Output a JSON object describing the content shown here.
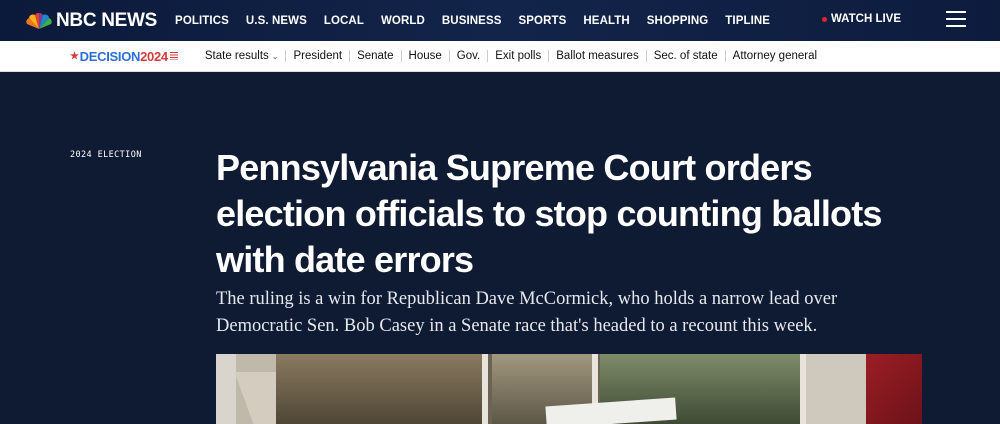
{
  "header": {
    "logo_text": "NBC NEWS",
    "nav": [
      "POLITICS",
      "U.S. NEWS",
      "LOCAL",
      "WORLD",
      "BUSINESS",
      "SPORTS",
      "HEALTH",
      "SHOPPING",
      "TIPLINE"
    ],
    "watch_live": "WATCH LIVE"
  },
  "subnav": {
    "logo_decision": "DECISION",
    "logo_year": "2024",
    "items": [
      "State results",
      "President",
      "Senate",
      "House",
      "Gov.",
      "Exit polls",
      "Ballot measures",
      "Sec. of state",
      "Attorney general"
    ]
  },
  "article": {
    "kicker": "2024 ELECTION",
    "headline": "Pennsylvania Supreme Court orders election officials to stop counting ballots with date errors",
    "dek": "The ruling is a win for Republican Dave McCormick, who holds a narrow lead over Democratic Sen. Bob Casey in a Senate race that's headed to a recount this week."
  },
  "colors": {
    "page_bg": "#0f1b33",
    "accent_red": "#e8242b",
    "decision_blue": "#2a6fd6",
    "decision_red": "#d63a3a"
  }
}
